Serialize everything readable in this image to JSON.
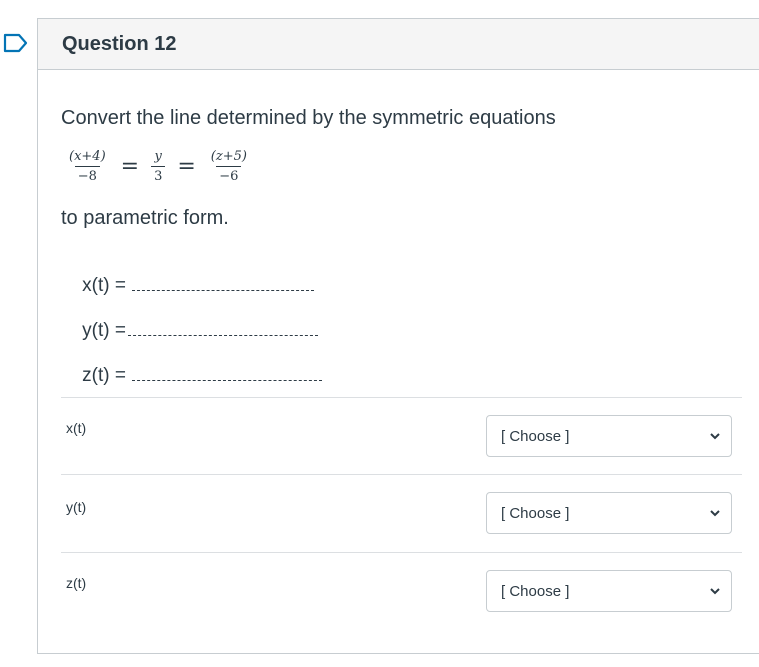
{
  "question": {
    "title": "Question 12",
    "intro": "Convert the line determined by the symmetric equations",
    "equation": {
      "frac1_num": "(x+4)",
      "frac1_den": "−8",
      "frac2_num": "y",
      "frac2_den": "3",
      "frac3_num": "(z+5)",
      "frac3_den": "−6",
      "eq_sign": "="
    },
    "outro": "to parametric form.",
    "lines": [
      {
        "label": "x(t) ="
      },
      {
        "label": "y(t) ="
      },
      {
        "label": "z(t) ="
      }
    ]
  },
  "answers": [
    {
      "label": "x(t)",
      "selected": "[ Choose ]"
    },
    {
      "label": "y(t)",
      "selected": "[ Choose ]"
    },
    {
      "label": "z(t)",
      "selected": "[ Choose ]"
    }
  ],
  "colors": {
    "text": "#2d3b45",
    "border": "#c7cdd1",
    "header_bg": "#f5f5f5",
    "flag": "#0374b5"
  }
}
